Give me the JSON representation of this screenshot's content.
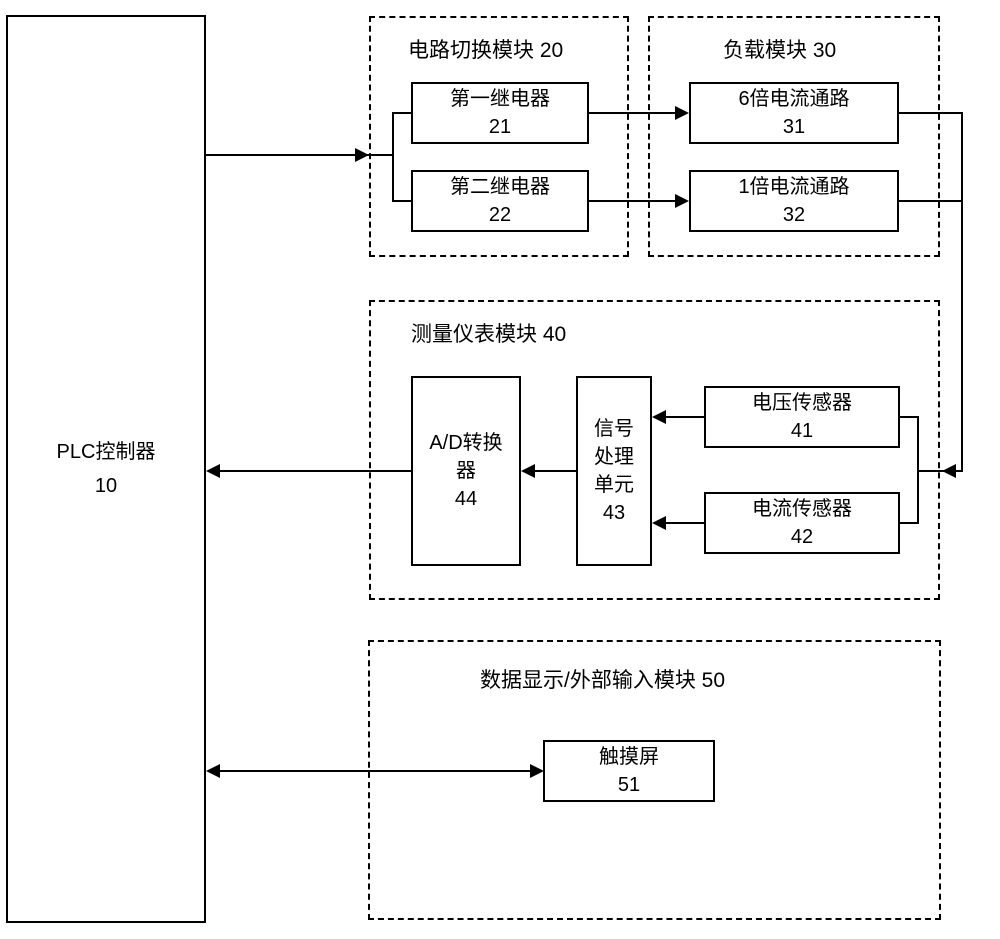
{
  "plc": {
    "label": "PLC控制器",
    "id": "10"
  },
  "module20": {
    "title": "电路切换模块  20",
    "b21": {
      "label": "第一继电器",
      "id": "21"
    },
    "b22": {
      "label": "第二继电器",
      "id": "22"
    }
  },
  "module30": {
    "title": "负载模块  30",
    "b31": {
      "label": "6倍电流通路",
      "id": "31"
    },
    "b32": {
      "label": "1倍电流通路",
      "id": "32"
    }
  },
  "module40": {
    "title": "测量仪表模块  40",
    "b41": {
      "label": "电压传感器",
      "id": "41"
    },
    "b42": {
      "label": "电流传感器",
      "id": "42"
    },
    "b43": {
      "line1": "信号",
      "line2": "处理",
      "line3": "单元",
      "id": "43"
    },
    "b44": {
      "line1": "A/D转换",
      "line2": "器",
      "id": "44"
    }
  },
  "module50": {
    "title": "数据显示/外部输入模块  50",
    "b51": {
      "label": "触摸屏",
      "id": "51"
    }
  }
}
